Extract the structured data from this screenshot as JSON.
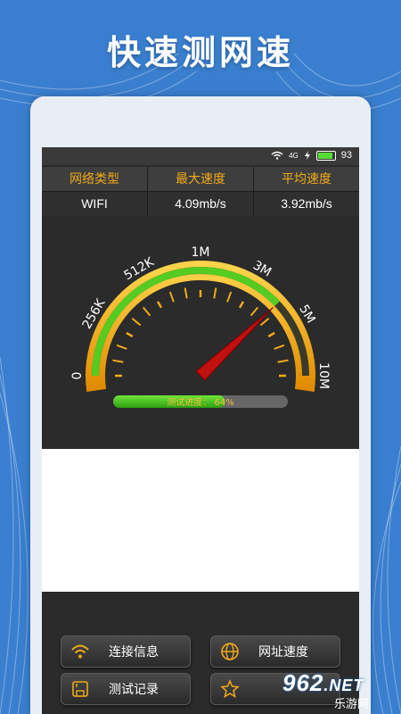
{
  "headline": "快速测网速",
  "status": {
    "net": "4G",
    "battery": "93",
    "battery_level": 0.93
  },
  "table": {
    "headers": [
      "网络类型",
      "最大速度",
      "平均速度"
    ],
    "values": [
      "WIFI",
      "4.09mb/s",
      "3.92mb/s"
    ]
  },
  "gauge": {
    "labels": [
      "0",
      "256K",
      "512K",
      "1M",
      "3M",
      "5M",
      "10M"
    ],
    "progress_text": "测试进度： 64%",
    "progress": 0.64,
    "needle_fraction": 0.76
  },
  "buttons": [
    {
      "label": "连接信息",
      "icon": "wifi-icon"
    },
    {
      "label": "网址速度",
      "icon": "globe-icon"
    },
    {
      "label": "测试记录",
      "icon": "save-icon"
    },
    {
      "label": "",
      "icon": "star-icon"
    }
  ],
  "watermark": {
    "brand": "962",
    "tld": ".NET",
    "sub": "乐游网"
  },
  "colors": {
    "accent": "#f0a91a",
    "gauge_green": "#55cc22",
    "needle": "#c01010",
    "background": "#3a7fcf"
  }
}
